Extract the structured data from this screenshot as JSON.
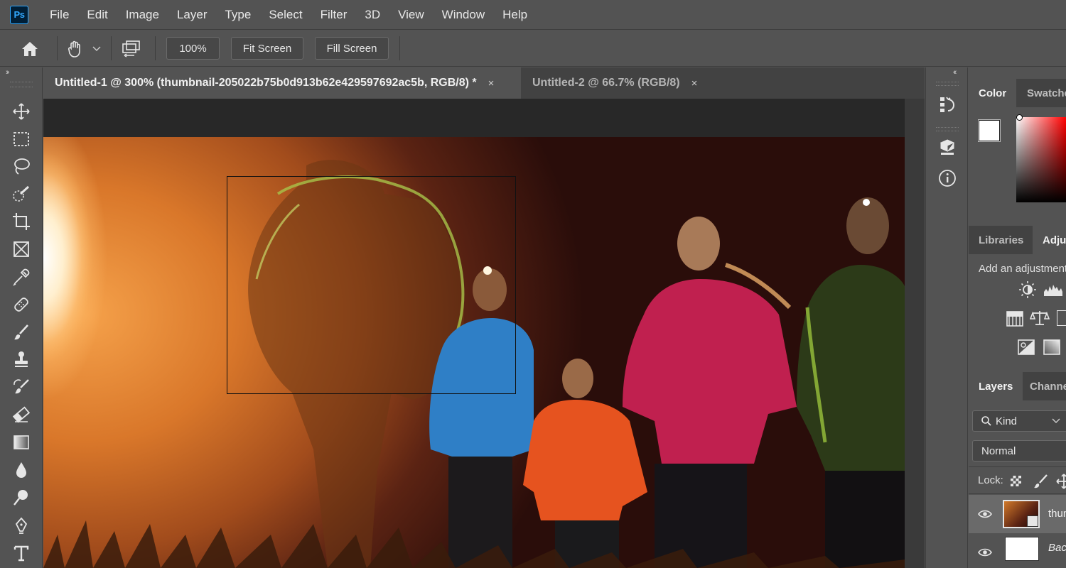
{
  "app": {
    "logo_text": "Ps"
  },
  "menu": [
    "File",
    "Edit",
    "Image",
    "Layer",
    "Type",
    "Select",
    "Filter",
    "3D",
    "View",
    "Window",
    "Help"
  ],
  "options": {
    "zoom_value": "100%",
    "fit_screen_label": "Fit Screen",
    "fill_screen_label": "Fill Screen"
  },
  "tabs": [
    {
      "label": "Untitled-1 @ 300% (thumbnail-205022b75b0d913b62e429597692ac5b, RGB/8) *",
      "close": "×"
    },
    {
      "label": "Untitled-2 @ 66.7% (RGB/8)",
      "close": "×"
    }
  ],
  "panels": {
    "color_tabs": [
      "Color",
      "Swatches"
    ],
    "library_tabs": [
      "Libraries",
      "Adjustments"
    ],
    "adjustment_hint": "Add an adjustment",
    "layer_tabs": [
      "Layers",
      "Channels"
    ],
    "kind_label": "Kind",
    "blend_mode": "Normal",
    "lock_label": "Lock:",
    "layers": [
      {
        "name": "thumbnail"
      },
      {
        "name": "Background"
      }
    ]
  },
  "colors": {
    "accent": "#31a8ff",
    "ui_bg": "#535353",
    "canvas_bg": "#282828"
  }
}
